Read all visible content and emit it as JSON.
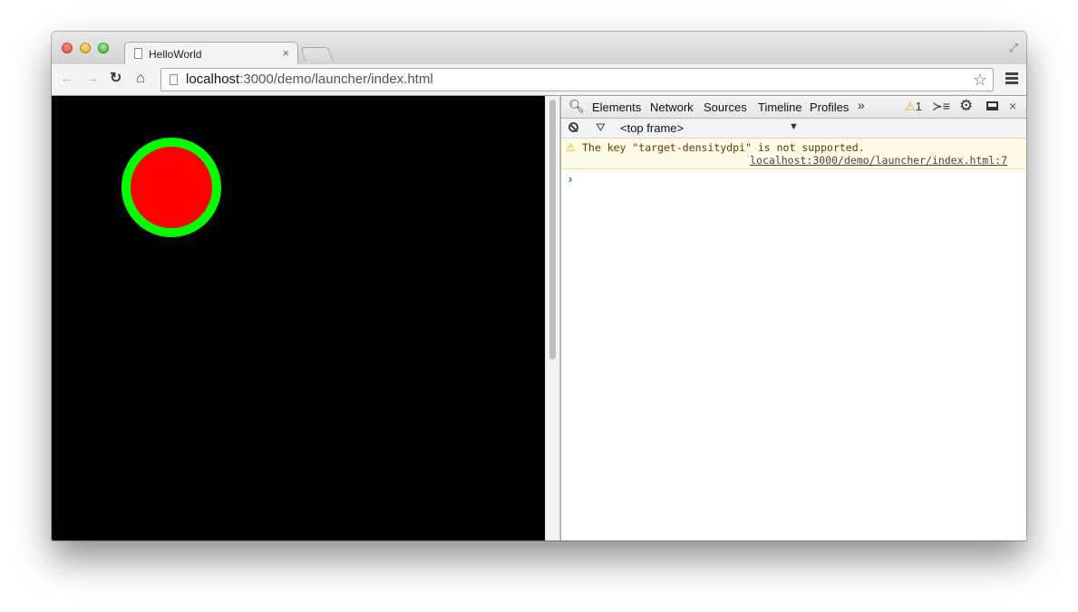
{
  "window": {
    "tab": {
      "title": "HelloWorld",
      "close": "×"
    },
    "fullscreen_icon": "⤢"
  },
  "toolbar": {
    "back": "←",
    "forward": "→",
    "reload": "↻",
    "home": "⌂",
    "url_host": "localhost",
    "url_rest": ":3000/demo/launcher/index.html",
    "star": "☆"
  },
  "page": {
    "background": "#000000",
    "circle_fill": "#ff0000",
    "circle_stroke": "#00ff00"
  },
  "devtools": {
    "search_icon": "🔍︎",
    "tabs": [
      "Elements",
      "Network",
      "Sources",
      "Timeline",
      "Profiles"
    ],
    "more": "»",
    "warning_icon": "⚠",
    "warning_count": "1",
    "exec_icon": "≻≡",
    "gear_icon": "⚙",
    "close": "×",
    "console": {
      "filter_icon": "⛛",
      "frame_label": "<top frame>",
      "frame_arrow": "▼",
      "messages": [
        {
          "icon": "⚠",
          "text": "The key \"target-densitydpi\" is not supported.",
          "source": "localhost:3000/demo/launcher/index.html:7"
        }
      ],
      "prompt": "›"
    }
  }
}
